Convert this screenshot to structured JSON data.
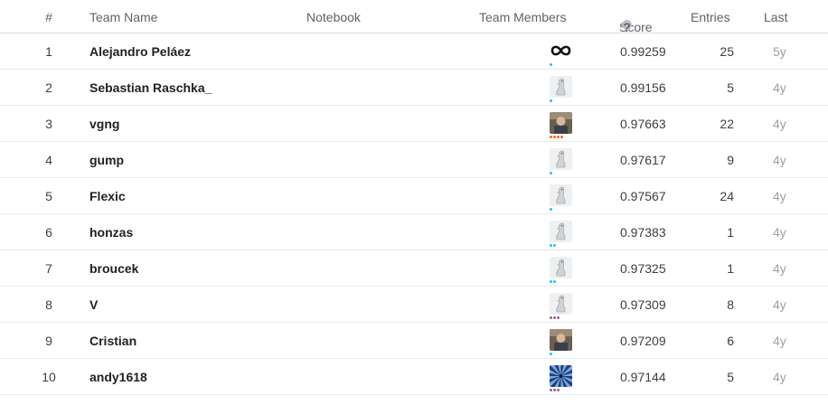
{
  "header": {
    "rank": "#",
    "team_name": "Team Name",
    "notebook": "Notebook",
    "team_members": "Team Members",
    "score": "Score",
    "entries": "Entries",
    "last": "Last",
    "score_help_icon": "help-icon"
  },
  "rows": [
    {
      "rank": "1",
      "team": "Alejandro Peláez",
      "score": "0.99259",
      "entries": "25",
      "last": "5y",
      "avatar": "infinity-logo",
      "tier_color": "#20beff",
      "tier_dots": 1
    },
    {
      "rank": "2",
      "team": "Sebastian Raschka_",
      "score": "0.99156",
      "entries": "5",
      "last": "4y",
      "avatar": "default-avatar",
      "tier_color": "#20beff",
      "tier_dots": 1
    },
    {
      "rank": "3",
      "team": "vgng",
      "score": "0.97663",
      "entries": "22",
      "last": "4y",
      "avatar": "photo-avatar",
      "tier_color": "#f96517",
      "tier_dots": 4
    },
    {
      "rank": "4",
      "team": "gump",
      "score": "0.97617",
      "entries": "9",
      "last": "4y",
      "avatar": "default-avatar",
      "tier_color": "#20beff",
      "tier_dots": 1
    },
    {
      "rank": "5",
      "team": "Flexic",
      "score": "0.97567",
      "entries": "24",
      "last": "4y",
      "avatar": "default-avatar",
      "tier_color": "#20beff",
      "tier_dots": 1
    },
    {
      "rank": "6",
      "team": "honzas",
      "score": "0.97383",
      "entries": "1",
      "last": "4y",
      "avatar": "default-avatar",
      "tier_color": "#20beff",
      "tier_dots": 2
    },
    {
      "rank": "7",
      "team": "broucek",
      "score": "0.97325",
      "entries": "1",
      "last": "4y",
      "avatar": "default-avatar",
      "tier_color": "#20beff",
      "tier_dots": 2
    },
    {
      "rank": "8",
      "team": "V",
      "score": "0.97309",
      "entries": "8",
      "last": "4y",
      "avatar": "default-avatar",
      "tier_color": "#95628f",
      "tier_dots": 3
    },
    {
      "rank": "9",
      "team": "Cristian",
      "score": "0.97209",
      "entries": "6",
      "last": "4y",
      "avatar": "photo-avatar",
      "tier_color": "#20beff",
      "tier_dots": 1
    },
    {
      "rank": "10",
      "team": "andy1618",
      "score": "0.97144",
      "entries": "5",
      "last": "4y",
      "avatar": "pattern-avatar",
      "tier_color": "#95628f",
      "tier_dots": 3
    }
  ]
}
